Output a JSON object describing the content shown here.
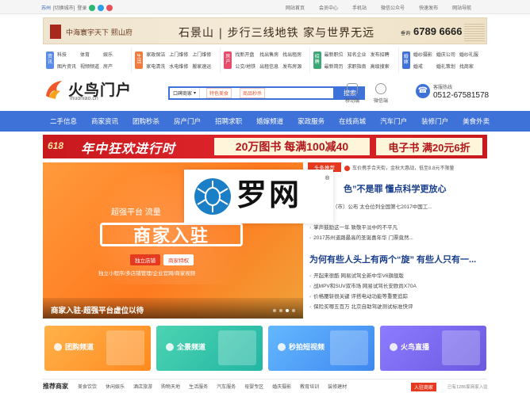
{
  "topbar": {
    "city": "苏州",
    "switch": "[切换城市]",
    "login": "登录",
    "links": [
      "网站首页",
      "会员中心",
      "手机站",
      "微信公众号",
      "快速发布",
      "网站导航"
    ]
  },
  "banner_ad": {
    "brand": "中海寰宇天下 熙山府",
    "slogan": "石景山 | 步行三线地铁 家与世界无远",
    "phone_label": "垂询",
    "phone": "6789 6666"
  },
  "category_groups": [
    {
      "icon": "资讯",
      "color": "#5b8be8",
      "links": [
        "科技",
        "体育",
        "娱乐",
        "图片资讯",
        "视频频道",
        "房产"
      ]
    },
    {
      "icon": "生活",
      "color": "#f07b3f",
      "links": [
        "家政保洁",
        "上门维修",
        "上门维修",
        "家电清洗",
        "水电维修",
        "搬家速运"
      ]
    },
    {
      "icon": "房产",
      "color": "#e74c6b",
      "links": [
        "找新开盘",
        "找出售房",
        "找出租房",
        "公交/地铁",
        "出租信息",
        "发布房源"
      ]
    },
    {
      "icon": "招聘",
      "color": "#3aa876",
      "links": [
        "最新职位",
        "知名企业",
        "发布招聘",
        "最新简历",
        "求职指南",
        "高级搜索"
      ]
    },
    {
      "icon": "婚嫁",
      "color": "#3f72d9",
      "links": [
        "婚纱摄影",
        "婚庆公司",
        "婚纱礼服",
        "婚戒",
        "婚礼策划",
        "找商家"
      ]
    }
  ],
  "header": {
    "brand": "火鸟门户",
    "domain": "ihuoniao.cn",
    "search_scope": "口碑商家",
    "suggest1": "特色美食",
    "suggest2": "商品秒杀",
    "search_button": "搜索",
    "mobile_label": "移动端",
    "wechat_label": "微信端",
    "hotline_label": "客服热线",
    "hotline": "0512-67581578"
  },
  "main_nav": [
    "二手信息",
    "商家资讯",
    "团购秒杀",
    "房产门户",
    "招聘求职",
    "婚嫁频道",
    "家政服务",
    "在线商城",
    "汽车门户",
    "装修门户",
    "美食外卖"
  ],
  "promo_banner": {
    "tag": "618",
    "title": "年中狂欢进行时",
    "offer1": "20万图书 每满100减40",
    "offer2": "电子书 满20元6折"
  },
  "slider": {
    "tagline": "超强平台 流量",
    "headline": "商家入驻",
    "pill1": "独立店铺",
    "pill2": "商家特权",
    "features": "独立小程序/多店铺管理/企业官网/商家视频",
    "caption": "商家入驻-超强平台虚位以待",
    "dots": [
      false,
      false,
      true,
      false
    ]
  },
  "news": {
    "tag": "头条推荐",
    "ticker": "车价携手合天街，金秋大惠战，低至8.8元不限量",
    "headline1": "色”不是罪 懂点科学更放心",
    "list1": [
      "业百强县（市）公布 太仓位列全国第七2017中国工...",
      "",
      "掌声鼓励这一年 致敬平淡中的不平凡",
      "2017苏州道路最高的圣诞喜年华 门票竟然..."
    ],
    "headline2": "为何有些人头上有两个“旋” 有些人只有一...",
    "list2": [
      "开起来很酷 网易试驾全新中华V6旗舰版",
      "战MPV和SUV双市场 网易试驾长安欧尚X70A",
      "价格腰斩很关键 评搭电动功能等重要追踪",
      "保险买哪五百万 北京自助驾驶测试标准快评"
    ]
  },
  "overlay_logo": {
    "text": "罗网",
    "reg": "®"
  },
  "feature_cards": [
    {
      "label": "团购频道"
    },
    {
      "label": "全景频道"
    },
    {
      "label": "秒拍短视频"
    },
    {
      "label": "火鸟直播"
    }
  ],
  "recommend": {
    "title": "推荐商家",
    "items": [
      "美食饮饮",
      "休闲娱乐",
      "酒店旅游",
      "购物天地",
      "生活服务",
      "汽车服务",
      "母婴专区",
      "婚庆摄影",
      "教育培训",
      "装修建材"
    ],
    "join_button": "入驻商家",
    "more": "已有1286家商家入驻"
  }
}
